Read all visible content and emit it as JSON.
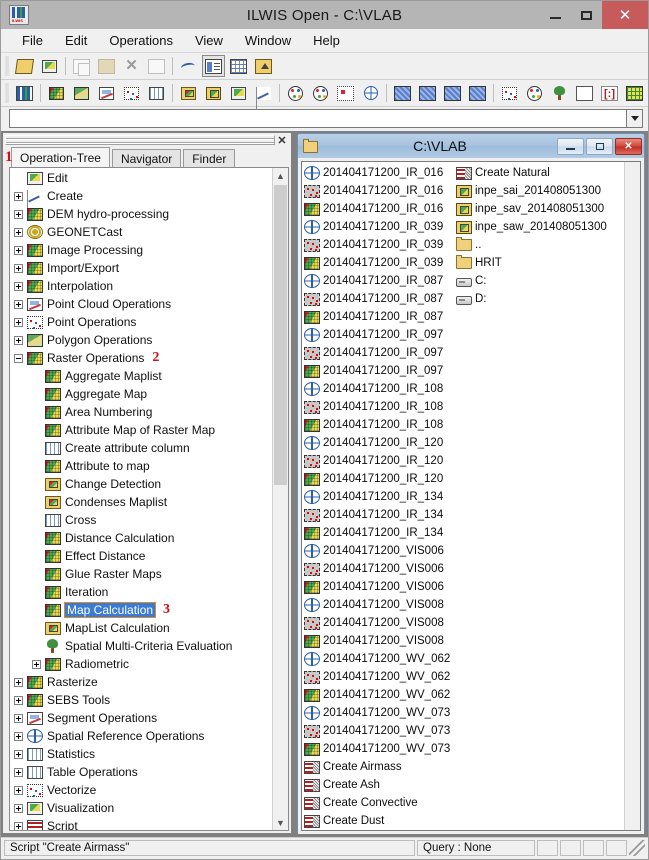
{
  "window": {
    "title": "ILWIS Open - C:\\VLAB",
    "app_icon": "ilwis-icon",
    "minimize": "–",
    "maximize": "□",
    "close": "✕"
  },
  "menubar": {
    "items": [
      "File",
      "Edit",
      "Operations",
      "View",
      "Window",
      "Help"
    ]
  },
  "toolbar_main": {
    "buttons": [
      {
        "name": "open-icon",
        "glyph": "open-folder"
      },
      {
        "name": "show-map-icon",
        "glyph": "show-map"
      },
      {
        "name": "copy-icon",
        "glyph": "copy"
      },
      {
        "name": "paste-icon",
        "glyph": "paste"
      },
      {
        "name": "delete-icon",
        "glyph": "delete"
      },
      {
        "name": "properties-icon",
        "glyph": "properties"
      },
      {
        "name": "statistics-icon",
        "glyph": "wave"
      },
      {
        "name": "list-view-icon",
        "glyph": "list-view"
      },
      {
        "name": "detail-view-icon",
        "glyph": "detail-view"
      },
      {
        "name": "up-one-level-icon",
        "glyph": "up-folder"
      }
    ]
  },
  "toolbar_operations": {
    "buttons": [
      {
        "name": "ilwis-logo-icon",
        "glyph": "ilwis"
      },
      {
        "name": "raster-map-icon",
        "glyph": "raster"
      },
      {
        "name": "polygon-map-icon",
        "glyph": "polygon"
      },
      {
        "name": "segment-map-icon",
        "glyph": "segment"
      },
      {
        "name": "point-map-icon",
        "glyph": "point"
      },
      {
        "name": "table-icon",
        "glyph": "table"
      },
      {
        "name": "maplist-icon",
        "glyph": "maplist"
      },
      {
        "name": "map-view-icon",
        "glyph": "map-view"
      },
      {
        "name": "pixel-info-icon",
        "glyph": "pixel-info"
      },
      {
        "name": "graph-icon",
        "glyph": "graph"
      },
      {
        "name": "domain-icon",
        "glyph": "domain"
      },
      {
        "name": "representation-icon",
        "glyph": "representation"
      },
      {
        "name": "coordinate-system-icon",
        "glyph": "coordsys"
      },
      {
        "name": "georeference-icon",
        "glyph": "georef"
      },
      {
        "name": "import-map-icon",
        "glyph": "import1"
      },
      {
        "name": "import-map2-icon",
        "glyph": "import2"
      },
      {
        "name": "import-map3-icon",
        "glyph": "import3"
      },
      {
        "name": "import-map4-icon",
        "glyph": "import4"
      },
      {
        "name": "filter-icon",
        "glyph": "filter"
      },
      {
        "name": "sample-set-icon",
        "glyph": "sampleset"
      },
      {
        "name": "decision-tree-icon",
        "glyph": "tree"
      },
      {
        "name": "new-object-icon",
        "glyph": "newdoc"
      },
      {
        "name": "matrix-icon",
        "glyph": "matrix"
      },
      {
        "name": "grid-icon",
        "glyph": "grid"
      },
      {
        "name": "function-icon",
        "glyph": "fn"
      },
      {
        "name": "script-icon",
        "glyph": "script"
      }
    ]
  },
  "command_line": {
    "value": "",
    "placeholder": "",
    "dropdown_icon": "chevron-down-icon"
  },
  "dock_pane": {
    "close_label": "✕",
    "annotation": "1",
    "tabs": [
      {
        "label": "Operation-Tree",
        "active": true
      },
      {
        "label": "Navigator",
        "active": false
      },
      {
        "label": "Finder",
        "active": false
      }
    ]
  },
  "operation_tree": {
    "items": [
      {
        "label": "Edit",
        "indent": 1,
        "toggle": "none",
        "icon": "monitor"
      },
      {
        "label": "Create",
        "indent": 1,
        "toggle": "plus",
        "icon": "create"
      },
      {
        "label": "DEM hydro-processing",
        "indent": 1,
        "toggle": "plus",
        "icon": "raster"
      },
      {
        "label": "GEONETCast",
        "indent": 1,
        "toggle": "plus",
        "icon": "geonetcast"
      },
      {
        "label": "Image Processing",
        "indent": 1,
        "toggle": "plus",
        "icon": "raster"
      },
      {
        "label": "Import/Export",
        "indent": 1,
        "toggle": "plus",
        "icon": "raster"
      },
      {
        "label": "Interpolation",
        "indent": 1,
        "toggle": "plus",
        "icon": "raster"
      },
      {
        "label": "Point Cloud Operations",
        "indent": 1,
        "toggle": "plus",
        "icon": "pointcloud"
      },
      {
        "label": "Point Operations",
        "indent": 1,
        "toggle": "plus",
        "icon": "point"
      },
      {
        "label": "Polygon Operations",
        "indent": 1,
        "toggle": "plus",
        "icon": "polygon"
      },
      {
        "label": "Raster Operations",
        "indent": 1,
        "toggle": "minus",
        "icon": "raster",
        "annotation": "2"
      },
      {
        "label": "Aggregate Maplist",
        "indent": 2,
        "toggle": "none",
        "icon": "raster"
      },
      {
        "label": "Aggregate Map",
        "indent": 2,
        "toggle": "none",
        "icon": "raster"
      },
      {
        "label": "Area Numbering",
        "indent": 2,
        "toggle": "none",
        "icon": "raster"
      },
      {
        "label": "Attribute Map of Raster Map",
        "indent": 2,
        "toggle": "none",
        "icon": "raster"
      },
      {
        "label": "Create attribute column",
        "indent": 2,
        "toggle": "none",
        "icon": "table"
      },
      {
        "label": "Attribute to map",
        "indent": 2,
        "toggle": "none",
        "icon": "raster"
      },
      {
        "label": "Change Detection",
        "indent": 2,
        "toggle": "none",
        "icon": "layers"
      },
      {
        "label": "Condenses Maplist",
        "indent": 2,
        "toggle": "none",
        "icon": "layers"
      },
      {
        "label": "Cross",
        "indent": 2,
        "toggle": "none",
        "icon": "table"
      },
      {
        "label": "Distance Calculation",
        "indent": 2,
        "toggle": "none",
        "icon": "raster"
      },
      {
        "label": "Effect Distance",
        "indent": 2,
        "toggle": "none",
        "icon": "raster"
      },
      {
        "label": "Glue Raster Maps",
        "indent": 2,
        "toggle": "none",
        "icon": "raster"
      },
      {
        "label": "Iteration",
        "indent": 2,
        "toggle": "none",
        "icon": "raster"
      },
      {
        "label": "Map Calculation",
        "indent": 2,
        "toggle": "none",
        "icon": "raster",
        "selected": true,
        "annotation": "3"
      },
      {
        "label": "MapList Calculation",
        "indent": 2,
        "toggle": "none",
        "icon": "layers"
      },
      {
        "label": "Spatial Multi-Criteria Evaluation",
        "indent": 2,
        "toggle": "none",
        "icon": "tree"
      },
      {
        "label": "Radiometric",
        "indent": 2,
        "toggle": "plus",
        "icon": "raster"
      },
      {
        "label": "Rasterize",
        "indent": 1,
        "toggle": "plus",
        "icon": "raster"
      },
      {
        "label": "SEBS Tools",
        "indent": 1,
        "toggle": "plus",
        "icon": "raster"
      },
      {
        "label": "Segment Operations",
        "indent": 1,
        "toggle": "plus",
        "icon": "pointcloud"
      },
      {
        "label": "Spatial Reference Operations",
        "indent": 1,
        "toggle": "plus",
        "icon": "globe"
      },
      {
        "label": "Statistics",
        "indent": 1,
        "toggle": "plus",
        "icon": "table"
      },
      {
        "label": "Table Operations",
        "indent": 1,
        "toggle": "plus",
        "icon": "table"
      },
      {
        "label": "Vectorize",
        "indent": 1,
        "toggle": "plus",
        "icon": "point"
      },
      {
        "label": "Visualization",
        "indent": 1,
        "toggle": "plus",
        "icon": "monitor"
      },
      {
        "label": "Script",
        "indent": 1,
        "toggle": "plus",
        "icon": "script"
      }
    ]
  },
  "child_window": {
    "title": "C:\\VLAB",
    "icon": "folder-icon",
    "minimize": "–",
    "restore": "□",
    "close": "✕"
  },
  "file_list": {
    "column_1": [
      {
        "label": "201404171200_IR_016",
        "icon": "georef"
      },
      {
        "label": "201404171200_IR_016",
        "icon": "pointmap"
      },
      {
        "label": "201404171200_IR_016",
        "icon": "rastermap"
      },
      {
        "label": "201404171200_IR_039",
        "icon": "georef"
      },
      {
        "label": "201404171200_IR_039",
        "icon": "pointmap"
      },
      {
        "label": "201404171200_IR_039",
        "icon": "rastermap"
      },
      {
        "label": "201404171200_IR_087",
        "icon": "georef"
      },
      {
        "label": "201404171200_IR_087",
        "icon": "pointmap"
      },
      {
        "label": "201404171200_IR_087",
        "icon": "rastermap"
      },
      {
        "label": "201404171200_IR_097",
        "icon": "georef"
      },
      {
        "label": "201404171200_IR_097",
        "icon": "pointmap"
      },
      {
        "label": "201404171200_IR_097",
        "icon": "rastermap"
      },
      {
        "label": "201404171200_IR_108",
        "icon": "georef"
      },
      {
        "label": "201404171200_IR_108",
        "icon": "pointmap"
      },
      {
        "label": "201404171200_IR_108",
        "icon": "rastermap"
      },
      {
        "label": "201404171200_IR_120",
        "icon": "georef"
      },
      {
        "label": "201404171200_IR_120",
        "icon": "pointmap"
      },
      {
        "label": "201404171200_IR_120",
        "icon": "rastermap"
      },
      {
        "label": "201404171200_IR_134",
        "icon": "georef"
      },
      {
        "label": "201404171200_IR_134",
        "icon": "pointmap"
      },
      {
        "label": "201404171200_IR_134",
        "icon": "rastermap"
      },
      {
        "label": "201404171200_VIS006",
        "icon": "georef"
      },
      {
        "label": "201404171200_VIS006",
        "icon": "pointmap"
      },
      {
        "label": "201404171200_VIS006",
        "icon": "rastermap"
      },
      {
        "label": "201404171200_VIS008",
        "icon": "georef"
      },
      {
        "label": "201404171200_VIS008",
        "icon": "pointmap"
      },
      {
        "label": "201404171200_VIS008",
        "icon": "rastermap"
      },
      {
        "label": "201404171200_WV_062",
        "icon": "georef"
      },
      {
        "label": "201404171200_WV_062",
        "icon": "pointmap"
      },
      {
        "label": "201404171200_WV_062",
        "icon": "rastermap"
      },
      {
        "label": "201404171200_WV_073",
        "icon": "georef"
      },
      {
        "label": "201404171200_WV_073",
        "icon": "pointmap"
      },
      {
        "label": "201404171200_WV_073",
        "icon": "rastermap"
      },
      {
        "label": "Create Airmass",
        "icon": "script"
      },
      {
        "label": "Create Ash",
        "icon": "script"
      },
      {
        "label": "Create Convective",
        "icon": "script"
      },
      {
        "label": "Create Dust",
        "icon": "script"
      }
    ],
    "column_2": [
      {
        "label": "Create Natural",
        "icon": "script"
      },
      {
        "label": "inpe_sai_201408051300",
        "icon": "maplist"
      },
      {
        "label": "inpe_sav_201408051300",
        "icon": "maplist"
      },
      {
        "label": "inpe_saw_201408051300",
        "icon": "maplist"
      },
      {
        "label": "..",
        "icon": "folder"
      },
      {
        "label": "HRIT",
        "icon": "folder"
      },
      {
        "label": "C:",
        "icon": "drive"
      },
      {
        "label": "D:",
        "icon": "drive"
      }
    ]
  },
  "statusbar": {
    "message": "Script \"Create Airmass\"",
    "query": "Query : None",
    "panes": [
      "",
      "",
      "",
      ""
    ]
  },
  "colors": {
    "titlebar": "#b5b5b5",
    "close_button": "#c75b5b",
    "child_titlebar": "#a7c3df",
    "selection_blue": "#3a7bd5",
    "selection_outline": "#e08a20",
    "annotation_red": "#d01010",
    "mdi_background": "#808080"
  }
}
